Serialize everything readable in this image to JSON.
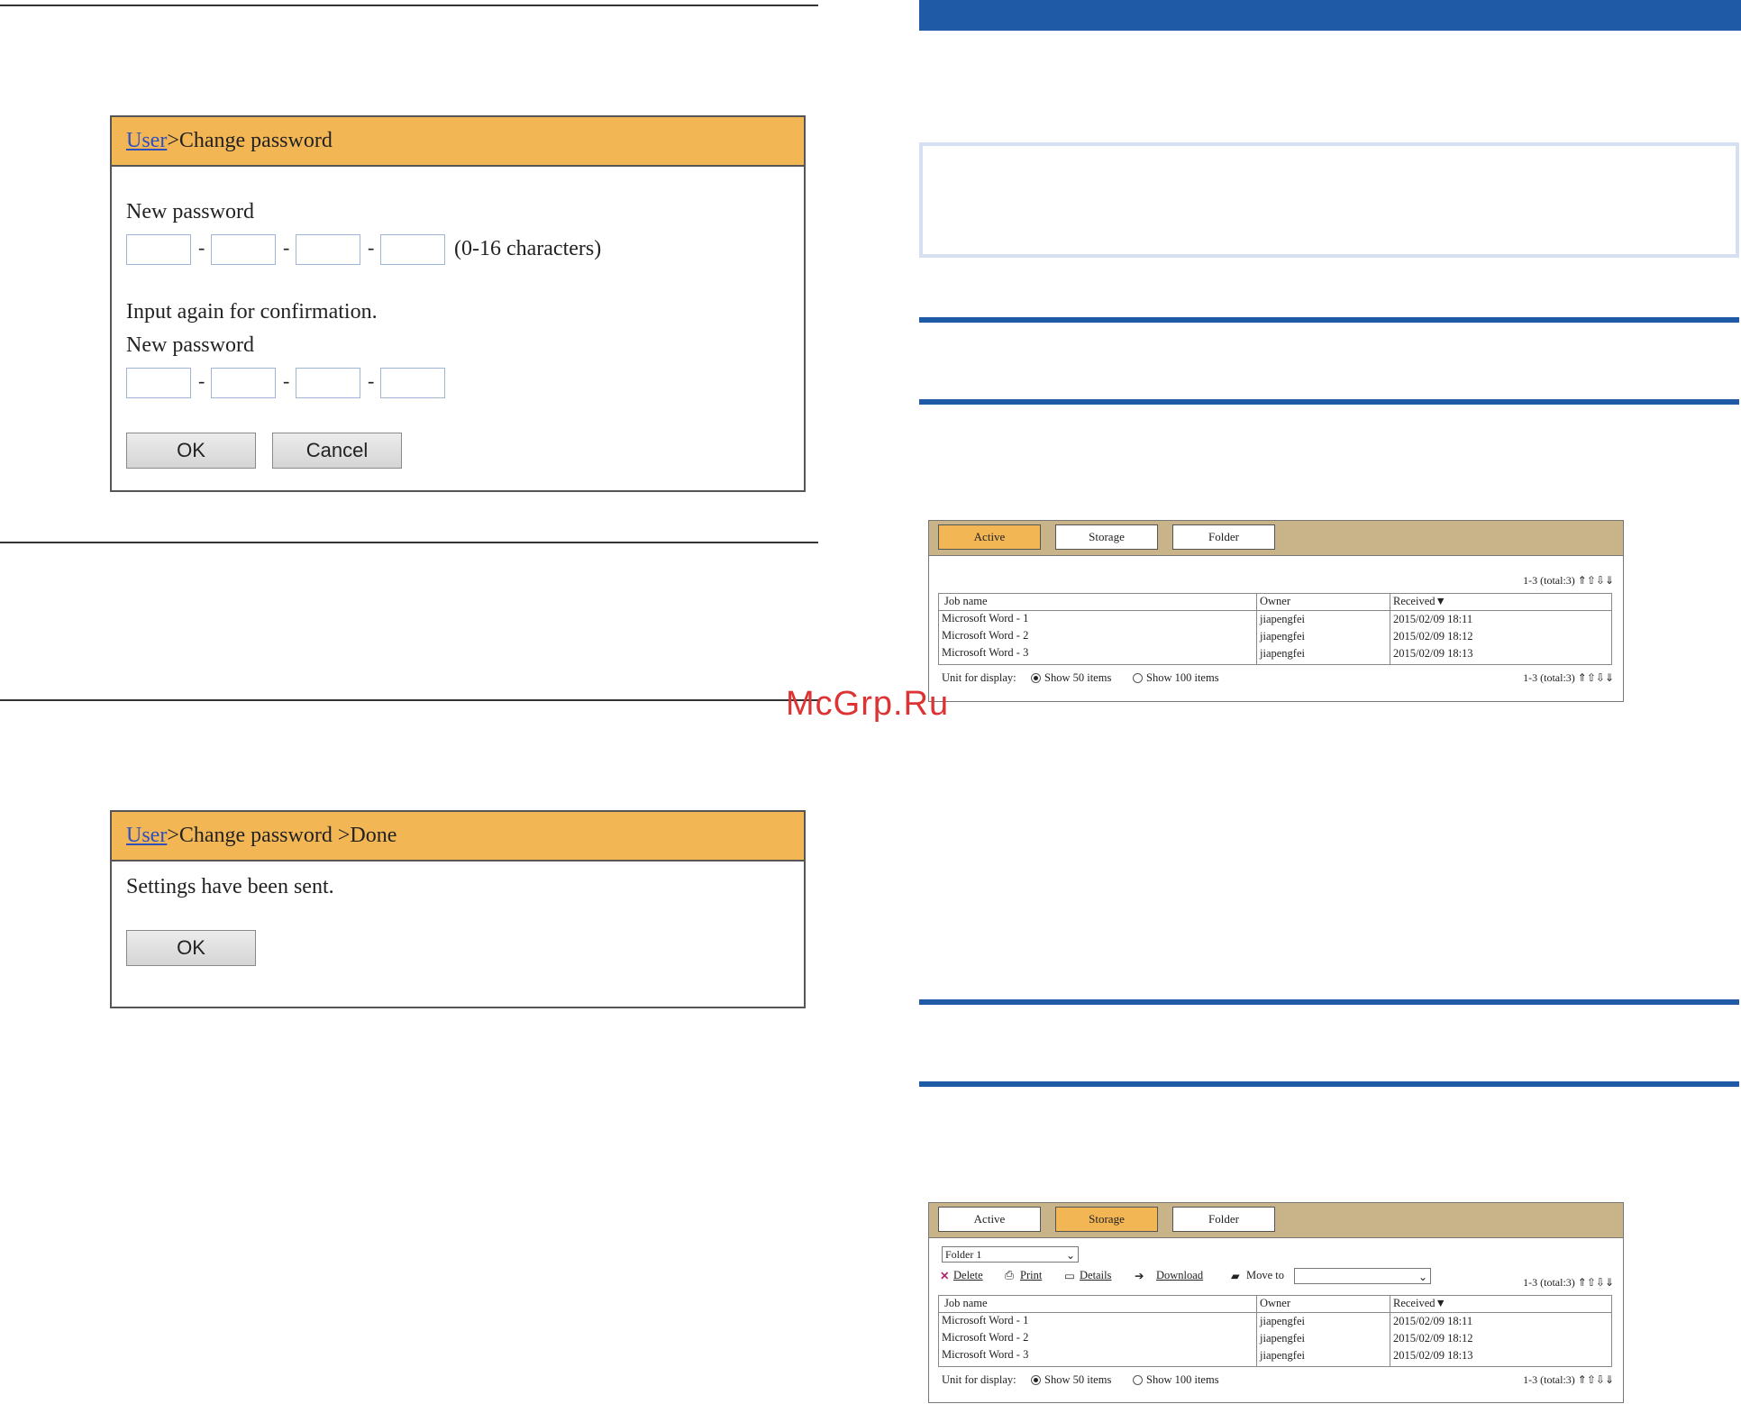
{
  "dialog1": {
    "crumb_link": "User",
    "crumb_rest": ">Change password",
    "new_password_label": "New password",
    "chars_hint": "(0-16 characters)",
    "confirm_label": "Input again for confirmation.",
    "new_password_label2": "New password",
    "ok": "OK",
    "cancel": "Cancel",
    "dash": "-"
  },
  "dialog2": {
    "crumb_link": "User",
    "crumb_rest": ">Change password >Done",
    "message": "Settings have been sent.",
    "ok": "OK"
  },
  "panel_active": {
    "tabs": [
      "Active",
      "Storage",
      "Folder"
    ],
    "active_tab": "Active",
    "count": "1-3 (total:3)",
    "nav_arrows": "⇑⇧⇩⇓",
    "columns": [
      "Job name",
      "Owner",
      "Received▼"
    ],
    "rows": [
      [
        "Microsoft Word - 1",
        "jiapengfei",
        "2015/02/09 18:11"
      ],
      [
        "Microsoft Word - 2",
        "jiapengfei",
        "2015/02/09 18:12"
      ],
      [
        "Microsoft Word - 3",
        "jiapengfei",
        "2015/02/09 18:13"
      ]
    ],
    "unit_label": "Unit for display:",
    "opt50": "Show 50 items",
    "opt100": "Show 100 items",
    "selected_option": "Show 50 items"
  },
  "panel_storage": {
    "tabs": [
      "Active",
      "Storage",
      "Folder"
    ],
    "active_tab": "Storage",
    "folder_select": "Folder 1",
    "toolbar": {
      "delete": "Delete",
      "print": "Print",
      "details": "Details",
      "download": "Download",
      "move_to": "Move to"
    },
    "count": "1-3 (total:3)",
    "nav_arrows": "⇑⇧⇩⇓",
    "columns": [
      "Job name",
      "Owner",
      "Received▼"
    ],
    "rows": [
      [
        "Microsoft Word - 1",
        "jiapengfei",
        "2015/02/09 18:11"
      ],
      [
        "Microsoft Word - 2",
        "jiapengfei",
        "2015/02/09 18:12"
      ],
      [
        "Microsoft Word - 3",
        "jiapengfei",
        "2015/02/09 18:13"
      ]
    ],
    "unit_label": "Unit for display:",
    "opt50": "Show 50 items",
    "opt100": "Show 100 items",
    "selected_option": "Show 50 items"
  },
  "watermark": "McGrp.Ru",
  "colors": {
    "title_bar": "#f3b654",
    "tab_bar": "#c9b48a",
    "rule_blue": "#1f5aa6",
    "link": "#2f4fbf",
    "watermark": "#dd3333"
  }
}
